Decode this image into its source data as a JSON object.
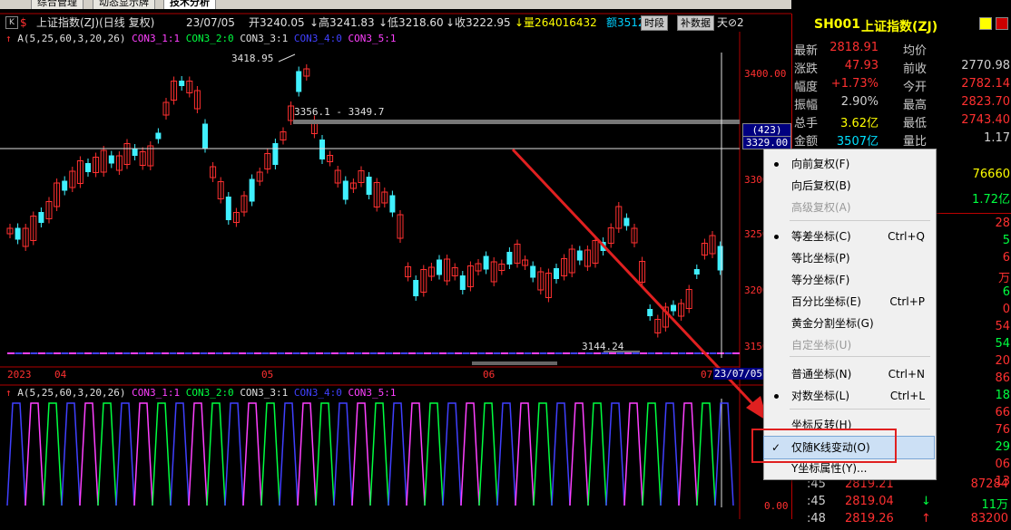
{
  "tabs": [
    "综合管理",
    "动态显示牌",
    "技术分析"
  ],
  "infobar": {
    "k_label": "K",
    "s_icon": "$",
    "title": "上证指数(ZJ)(日线 复权)",
    "date": "23/07/05",
    "open": "开3240.05",
    "high": "↓高3241.83",
    "low": "↓低3218.60",
    "close": "↓收3222.95",
    "vol": "↓量264016432",
    "amount": "额3512",
    "btn_period": "时段",
    "btn_supplement": "补数据",
    "tail": "天⊘2"
  },
  "main_indicator": {
    "prefix": "A(5,25,60,3,20,26)",
    "c1": "CON3_1:1",
    "c2": "CON3_2:0",
    "c3": "CON3_3:1",
    "c4": "CON3_4:0",
    "c5": "CON3_5:1"
  },
  "sub_indicator": {
    "prefix": "A(5,25,60,3,20,26)",
    "c1": "CON3_1:1",
    "c2": "CON3_2:0",
    "c3": "CON3_3:1",
    "c4": "CON3_4:0",
    "c5": "CON3_5:1"
  },
  "chart": {
    "high_label": "3418.95",
    "low_label": "3144.24",
    "range_label": "3356.1 - 3349.7",
    "cursor_count": "(423)",
    "cursor_price": "3329.00",
    "y_ticks": [
      "3400.00",
      "3350",
      "3300",
      "3250",
      "3200",
      "3150"
    ],
    "sub_tick": "0.00",
    "x_labels": [
      "2023",
      "04",
      "05",
      "06",
      "07",
      "23/07/05"
    ]
  },
  "right_panel": {
    "code": "SH001",
    "name": "上证指数(ZJ)",
    "rows": [
      {
        "l1": "最新",
        "v1": "2818.91",
        "c1": "#ff3030",
        "l2": "均价",
        "v2": ""
      },
      {
        "l1": "涨跌",
        "v1": "47.93",
        "c1": "#ff3030",
        "l2": "前收",
        "v2": "2770.98",
        "c2": "#d0d0d0"
      },
      {
        "l1": "幅度",
        "v1": "+1.73%",
        "c1": "#ff3030",
        "l2": "今开",
        "v2": "2782.14",
        "c2": "#ff3030"
      },
      {
        "l1": "振幅",
        "v1": "2.90%",
        "c1": "#d0d0d0",
        "l2": "最高",
        "v2": "2823.70",
        "c2": "#ff3030"
      },
      {
        "l1": "总手",
        "v1": "3.62亿",
        "c1": "#ffff00",
        "l2": "最低",
        "v2": "2743.40",
        "c2": "#ff3030"
      },
      {
        "l1": "金额",
        "v1": "3507亿",
        "c1": "#00e0ff",
        "l2": "量比",
        "v2": "1.17",
        "c2": "#d0d0d0"
      }
    ],
    "extra1": "76660",
    "extra2": "1.72亿",
    "side_values": [
      "28",
      "5",
      "6",
      "万",
      "6",
      "0",
      "54",
      "54",
      "20",
      "86",
      "18",
      "66",
      "76",
      "29",
      "06",
      "13"
    ],
    "ticks": [
      {
        "t": ":45",
        "p": "2819.21",
        "a": "",
        "v": "87284"
      },
      {
        "t": ":45",
        "p": "2819.04",
        "a": "↓",
        "v": "11万"
      },
      {
        "t": ":48",
        "p": "2819.26",
        "a": "↑",
        "v": "83200"
      }
    ]
  },
  "menu": {
    "items": [
      {
        "label": "向前复权(F)",
        "shortcut": "",
        "state": "bullet"
      },
      {
        "label": "向后复权(B)",
        "shortcut": "",
        "state": ""
      },
      {
        "label": "高级复权(A)",
        "shortcut": "",
        "state": "disabled"
      },
      {
        "label": "等差坐标(C)",
        "shortcut": "Ctrl+Q",
        "state": "bullet"
      },
      {
        "label": "等比坐标(P)",
        "shortcut": "",
        "state": ""
      },
      {
        "label": "等分坐标(F)",
        "shortcut": "",
        "state": ""
      },
      {
        "label": "百分比坐标(E)",
        "shortcut": "Ctrl+P",
        "state": ""
      },
      {
        "label": "黄金分割坐标(G)",
        "shortcut": "",
        "state": ""
      },
      {
        "label": "自定坐标(U)",
        "shortcut": "",
        "state": "disabled"
      },
      {
        "label": "普通坐标(N)",
        "shortcut": "Ctrl+N",
        "state": ""
      },
      {
        "label": "对数坐标(L)",
        "shortcut": "Ctrl+L",
        "state": "bullet"
      },
      {
        "label": "坐标反转(H)",
        "shortcut": "",
        "state": ""
      },
      {
        "label": "仅随K线变动(O)",
        "shortcut": "",
        "state": "check"
      },
      {
        "label": "Y坐标属性(Y)...",
        "shortcut": "",
        "state": ""
      }
    ]
  }
}
